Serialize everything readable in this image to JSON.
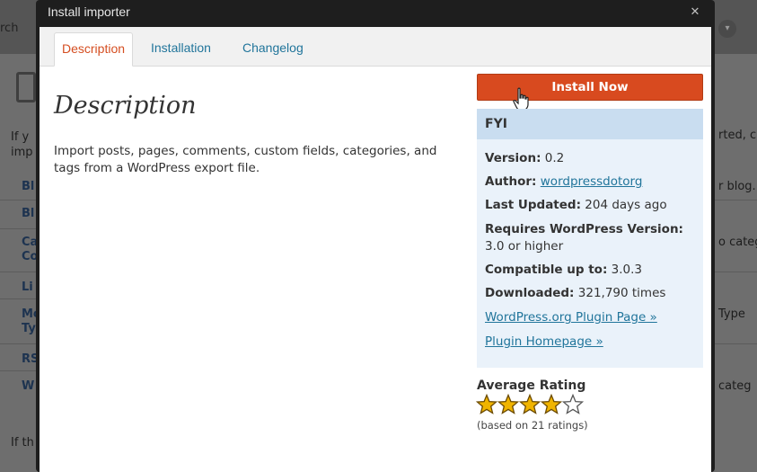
{
  "background": {
    "search_fragment": "rch",
    "left_fragments": [
      "If y",
      "imp",
      "If th"
    ],
    "left_links": [
      "Bl",
      "Bl",
      "Ca",
      "Co",
      "Li",
      "Mo",
      "Ty",
      "RS",
      "W"
    ],
    "right_fragments": [
      "rted, c",
      "r blog.",
      "o categ",
      "Type",
      "categ"
    ]
  },
  "modal": {
    "title": "Install importer",
    "close_glyph": "✕"
  },
  "tabs": [
    {
      "label": "Description",
      "active": true
    },
    {
      "label": "Installation",
      "active": false
    },
    {
      "label": "Changelog",
      "active": false
    }
  ],
  "description": {
    "heading": "Description",
    "body": "Import posts, pages, comments, custom fields, categories, and tags from a WordPress export file."
  },
  "install_button": {
    "label": "Install Now"
  },
  "fyi": {
    "title": "FYI",
    "version_label": "Version:",
    "version_value": "0.2",
    "author_label": "Author:",
    "author_value": "wordpressdotorg",
    "updated_label": "Last Updated:",
    "updated_value": "204 days ago",
    "requires_label": "Requires WordPress Version:",
    "requires_value": "3.0 or higher",
    "compatible_label": "Compatible up to:",
    "compatible_value": "3.0.3",
    "downloaded_label": "Downloaded:",
    "downloaded_value": "321,790 times",
    "plugin_page_link": "WordPress.org Plugin Page »",
    "homepage_link": "Plugin Homepage »"
  },
  "rating": {
    "title": "Average Rating",
    "stars_filled": 4,
    "stars_total": 5,
    "note": "(based on 21 ratings)"
  },
  "colors": {
    "accent_orange": "#d84a1f",
    "link_blue": "#21759b",
    "fyi_background": "#eaf2fa",
    "fyi_header": "#c9ddf0",
    "star_gold": "#f0b400"
  }
}
